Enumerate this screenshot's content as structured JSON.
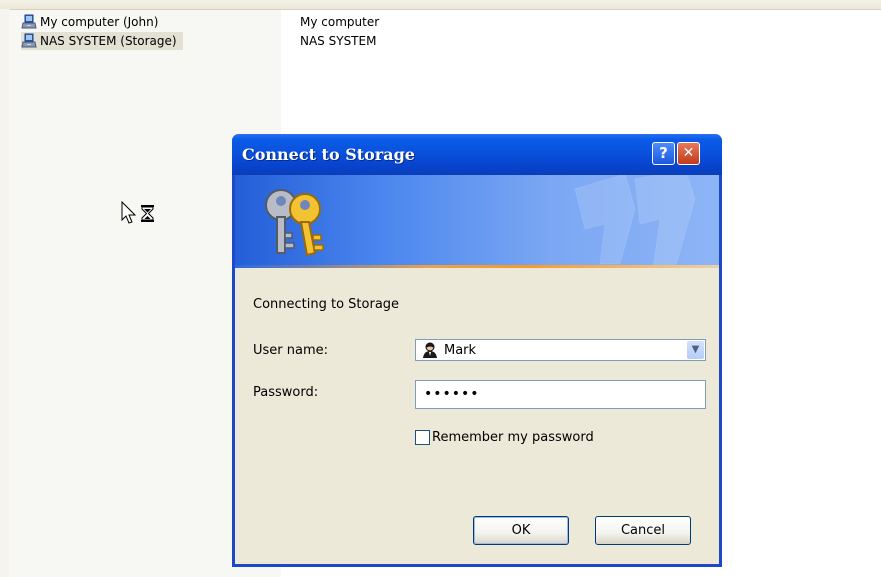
{
  "explorer": {
    "rows": [
      {
        "name": "My computer (John)",
        "description": "My computer",
        "icon": "computer-share-icon",
        "selected": false
      },
      {
        "name": "NAS SYSTEM (Storage)",
        "description": "NAS SYSTEM",
        "icon": "computer-share-icon",
        "selected": true
      }
    ]
  },
  "cursor": {
    "icon": "busy-arrow-hourglass-icon"
  },
  "dialog": {
    "title": "Connect to Storage",
    "help_button_label": "?",
    "close_button_label": "✕",
    "banner_icon": "keys-icon",
    "connecting_text": "Connecting to Storage",
    "username_label": "User name:",
    "username_value": "Mark",
    "username_icon": "user-icon",
    "password_label": "Password:",
    "password_value": "••••••",
    "remember_label": "Remember my password",
    "remember_checked": false,
    "ok_label": "OK",
    "cancel_label": "Cancel"
  },
  "colors": {
    "titlebar": "#0a53de",
    "close_button": "#c13b1b",
    "dialog_body": "#ece9d8",
    "banner_accent": "#f79a28"
  }
}
